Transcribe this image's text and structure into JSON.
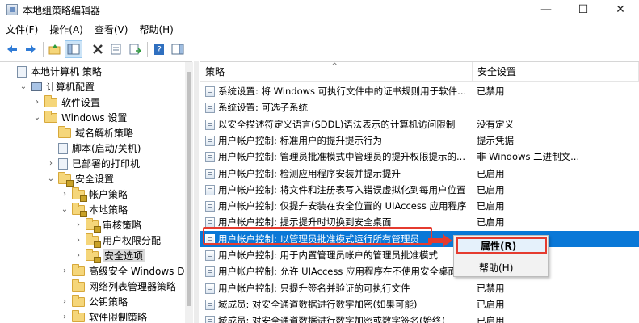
{
  "window": {
    "title": "本地组策略编辑器",
    "minimize": "—",
    "maximize": "☐",
    "close": "✕"
  },
  "menu": [
    "文件(F)",
    "操作(A)",
    "查看(V)",
    "帮助(H)"
  ],
  "toolbar_icons": [
    "back-arrow-icon",
    "forward-arrow-icon",
    "up-folder-icon",
    "show-hide-tree-icon",
    "delete-icon",
    "properties-icon",
    "export-list-icon",
    "help-icon",
    "show-pane-icon"
  ],
  "tree": [
    {
      "label": "本地计算机 策略",
      "indent": 0,
      "toggle": "",
      "icon": "doc"
    },
    {
      "label": "计算机配置",
      "indent": 1,
      "toggle": "⌄",
      "icon": "pc"
    },
    {
      "label": "软件设置",
      "indent": 2,
      "toggle": "›",
      "icon": "folder"
    },
    {
      "label": "Windows 设置",
      "indent": 2,
      "toggle": "⌄",
      "icon": "folder"
    },
    {
      "label": "域名解析策略",
      "indent": 3,
      "toggle": "",
      "icon": "folder"
    },
    {
      "label": "脚本(启动/关机)",
      "indent": 3,
      "toggle": "",
      "icon": "doc"
    },
    {
      "label": "已部署的打印机",
      "indent": 3,
      "toggle": "›",
      "icon": "doc"
    },
    {
      "label": "安全设置",
      "indent": 3,
      "toggle": "⌄",
      "icon": "lockfolder"
    },
    {
      "label": "帐户策略",
      "indent": 4,
      "toggle": "›",
      "icon": "lockfolder"
    },
    {
      "label": "本地策略",
      "indent": 4,
      "toggle": "⌄",
      "icon": "lockfolder"
    },
    {
      "label": "审核策略",
      "indent": 5,
      "toggle": "›",
      "icon": "lockfolder"
    },
    {
      "label": "用户权限分配",
      "indent": 5,
      "toggle": "›",
      "icon": "lockfolder"
    },
    {
      "label": "安全选项",
      "indent": 5,
      "toggle": "›",
      "icon": "lockfolder",
      "selected": true
    },
    {
      "label": "高级安全 Windows Defe",
      "indent": 4,
      "toggle": "›",
      "icon": "folder"
    },
    {
      "label": "网络列表管理器策略",
      "indent": 4,
      "toggle": "",
      "icon": "folder"
    },
    {
      "label": "公钥策略",
      "indent": 4,
      "toggle": "›",
      "icon": "folder"
    },
    {
      "label": "软件限制策略",
      "indent": 4,
      "toggle": "›",
      "icon": "folder"
    }
  ],
  "columns": {
    "policy": "策略",
    "setting": "安全设置"
  },
  "rows": [
    {
      "policy": "系统设置: 将 Windows 可执行文件中的证书规则用于软件...",
      "setting": "已禁用"
    },
    {
      "policy": "系统设置: 可选子系统",
      "setting": ""
    },
    {
      "policy": "以安全描述符定义语言(SDDL)语法表示的计算机访问限制",
      "setting": "没有定义"
    },
    {
      "policy": "用户帐户控制: 标准用户的提升提示行为",
      "setting": "提示凭据"
    },
    {
      "policy": "用户帐户控制: 管理员批准模式中管理员的提升权限提示的...",
      "setting": "非 Windows 二进制文..."
    },
    {
      "policy": "用户帐户控制: 检测应用程序安装并提示提升",
      "setting": "已启用"
    },
    {
      "policy": "用户帐户控制: 将文件和注册表写入错误虚拟化到每用户位置",
      "setting": "已启用"
    },
    {
      "policy": "用户帐户控制: 仅提升安装在安全位置的 UIAccess 应用程序",
      "setting": "已启用"
    },
    {
      "policy": "用户帐户控制: 提示提升时切换到安全桌面",
      "setting": "已启用"
    },
    {
      "policy": "用户帐户控制: 以管理员批准模式运行所有管理员",
      "setting": "",
      "selected": true
    },
    {
      "policy": "用户帐户控制: 用于内置管理员帐户的管理员批准模式",
      "setting": ""
    },
    {
      "policy": "用户帐户控制: 允许 UIAccess 应用程序在不使用安全桌面...",
      "setting": ""
    },
    {
      "policy": "用户帐户控制: 只提升签名并验证的可执行文件",
      "setting": "已禁用"
    },
    {
      "policy": "域成员: 对安全通道数据进行数字加密(如果可能)",
      "setting": "已启用"
    },
    {
      "policy": "域成员: 对安全通道数据进行数字加密或数字签名(始终)",
      "setting": "已启用"
    }
  ],
  "context_menu": {
    "properties": "属性(R)",
    "help": "帮助(H)"
  },
  "colors": {
    "selection": "#0a78d7",
    "annotation_red": "#e53b2f"
  }
}
